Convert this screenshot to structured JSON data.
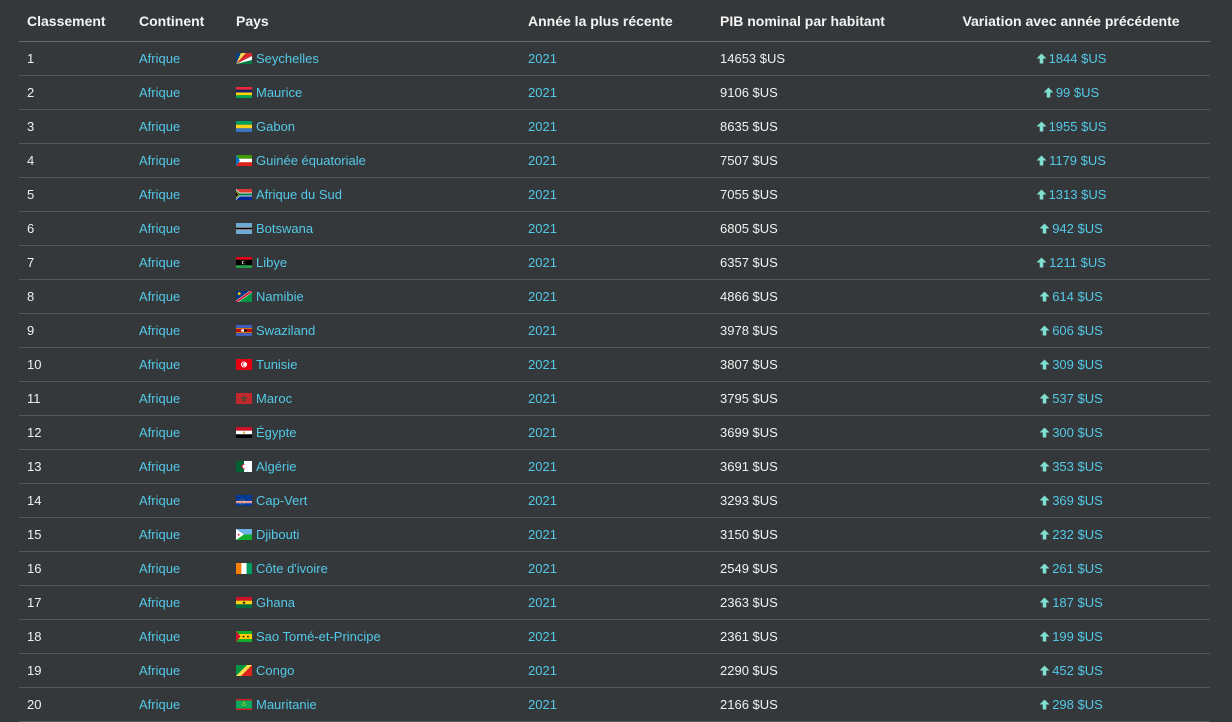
{
  "headers": {
    "rank": "Classement",
    "continent": "Continent",
    "country": "Pays",
    "year": "Année la plus récente",
    "gdp": "PIB nominal par habitant",
    "variation": "Variation avec année précédente"
  },
  "colors": {
    "background": "#35383a",
    "link": "#53c9e8",
    "text": "#f1f1f1",
    "up_arrow": "#7fe0d0"
  },
  "rows": [
    {
      "rank": "1",
      "continent": "Afrique",
      "country": "Seychelles",
      "flag": "seychelles-flag-icon",
      "year": "2021",
      "gdp": "14653 $US",
      "variation": "1844 $US",
      "trend": "up"
    },
    {
      "rank": "2",
      "continent": "Afrique",
      "country": "Maurice",
      "flag": "mauritius-flag-icon",
      "year": "2021",
      "gdp": "9106 $US",
      "variation": "99 $US",
      "trend": "up"
    },
    {
      "rank": "3",
      "continent": "Afrique",
      "country": "Gabon",
      "flag": "gabon-flag-icon",
      "year": "2021",
      "gdp": "8635 $US",
      "variation": "1955 $US",
      "trend": "up"
    },
    {
      "rank": "4",
      "continent": "Afrique",
      "country": "Guinée équatoriale",
      "flag": "eq-guinea-flag-icon",
      "year": "2021",
      "gdp": "7507 $US",
      "variation": "1179 $US",
      "trend": "up"
    },
    {
      "rank": "5",
      "continent": "Afrique",
      "country": "Afrique du Sud",
      "flag": "south-africa-flag-icon",
      "year": "2021",
      "gdp": "7055 $US",
      "variation": "1313 $US",
      "trend": "up"
    },
    {
      "rank": "6",
      "continent": "Afrique",
      "country": "Botswana",
      "flag": "botswana-flag-icon",
      "year": "2021",
      "gdp": "6805 $US",
      "variation": "942 $US",
      "trend": "up"
    },
    {
      "rank": "7",
      "continent": "Afrique",
      "country": "Libye",
      "flag": "libya-flag-icon",
      "year": "2021",
      "gdp": "6357 $US",
      "variation": "1211 $US",
      "trend": "up"
    },
    {
      "rank": "8",
      "continent": "Afrique",
      "country": "Namibie",
      "flag": "namibia-flag-icon",
      "year": "2021",
      "gdp": "4866 $US",
      "variation": "614 $US",
      "trend": "up"
    },
    {
      "rank": "9",
      "continent": "Afrique",
      "country": "Swaziland",
      "flag": "eswatini-flag-icon",
      "year": "2021",
      "gdp": "3978 $US",
      "variation": "606 $US",
      "trend": "up"
    },
    {
      "rank": "10",
      "continent": "Afrique",
      "country": "Tunisie",
      "flag": "tunisia-flag-icon",
      "year": "2021",
      "gdp": "3807 $US",
      "variation": "309 $US",
      "trend": "up"
    },
    {
      "rank": "11",
      "continent": "Afrique",
      "country": "Maroc",
      "flag": "morocco-flag-icon",
      "year": "2021",
      "gdp": "3795 $US",
      "variation": "537 $US",
      "trend": "up"
    },
    {
      "rank": "12",
      "continent": "Afrique",
      "country": "Égypte",
      "flag": "egypt-flag-icon",
      "year": "2021",
      "gdp": "3699 $US",
      "variation": "300 $US",
      "trend": "up"
    },
    {
      "rank": "13",
      "continent": "Afrique",
      "country": "Algérie",
      "flag": "algeria-flag-icon",
      "year": "2021",
      "gdp": "3691 $US",
      "variation": "353 $US",
      "trend": "up"
    },
    {
      "rank": "14",
      "continent": "Afrique",
      "country": "Cap-Vert",
      "flag": "cape-verde-flag-icon",
      "year": "2021",
      "gdp": "3293 $US",
      "variation": "369 $US",
      "trend": "up"
    },
    {
      "rank": "15",
      "continent": "Afrique",
      "country": "Djibouti",
      "flag": "djibouti-flag-icon",
      "year": "2021",
      "gdp": "3150 $US",
      "variation": "232 $US",
      "trend": "up"
    },
    {
      "rank": "16",
      "continent": "Afrique",
      "country": "Côte d'ivoire",
      "flag": "ivory-coast-flag-icon",
      "year": "2021",
      "gdp": "2549 $US",
      "variation": "261 $US",
      "trend": "up"
    },
    {
      "rank": "17",
      "continent": "Afrique",
      "country": "Ghana",
      "flag": "ghana-flag-icon",
      "year": "2021",
      "gdp": "2363 $US",
      "variation": "187 $US",
      "trend": "up"
    },
    {
      "rank": "18",
      "continent": "Afrique",
      "country": "Sao Tomé-et-Principe",
      "flag": "sao-tome-flag-icon",
      "year": "2021",
      "gdp": "2361 $US",
      "variation": "199 $US",
      "trend": "up"
    },
    {
      "rank": "19",
      "continent": "Afrique",
      "country": "Congo",
      "flag": "congo-flag-icon",
      "year": "2021",
      "gdp": "2290 $US",
      "variation": "452 $US",
      "trend": "up"
    },
    {
      "rank": "20",
      "continent": "Afrique",
      "country": "Mauritanie",
      "flag": "mauritania-flag-icon",
      "year": "2021",
      "gdp": "2166 $US",
      "variation": "298 $US",
      "trend": "up"
    }
  ]
}
